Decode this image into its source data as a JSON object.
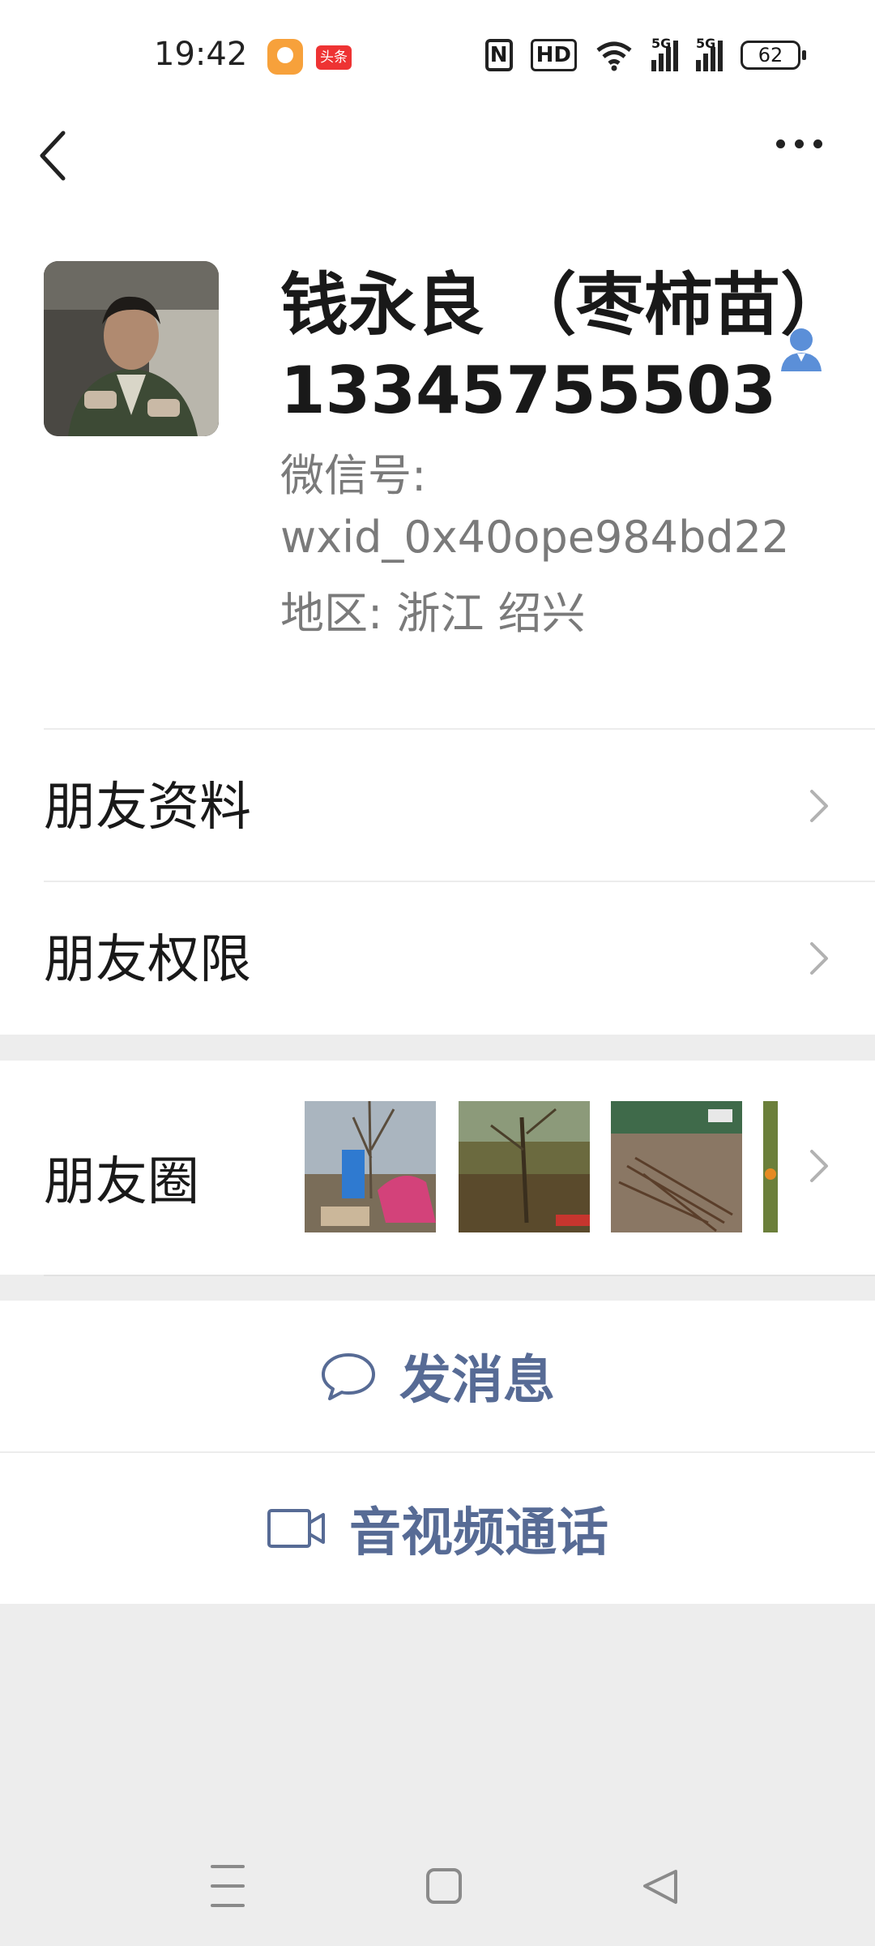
{
  "status_bar": {
    "time": "19:42",
    "app2_label": "头条",
    "nfc": "N",
    "hd": "HD",
    "sim1": "5G",
    "sim2": "5G",
    "battery": "62"
  },
  "header": {
    "back_icon": "chevron-left-icon",
    "more_icon": "more-dots-icon"
  },
  "profile": {
    "name": "钱永良 （枣柿苗）",
    "phone": "13345755503",
    "wechat_id_label": "微信号:",
    "wechat_id": "wxid_0x40ope984bd22",
    "region": "地区:  浙江  绍兴"
  },
  "menu": {
    "friend_profile": "朋友资料",
    "friend_permissions": "朋友权限",
    "moments": "朋友圈"
  },
  "actions": {
    "message": "发消息",
    "call": "音视频通话"
  },
  "colors": {
    "link_blue": "#576b95",
    "contact_icon_blue": "#5b8fd8",
    "page_bg": "#ededed"
  }
}
